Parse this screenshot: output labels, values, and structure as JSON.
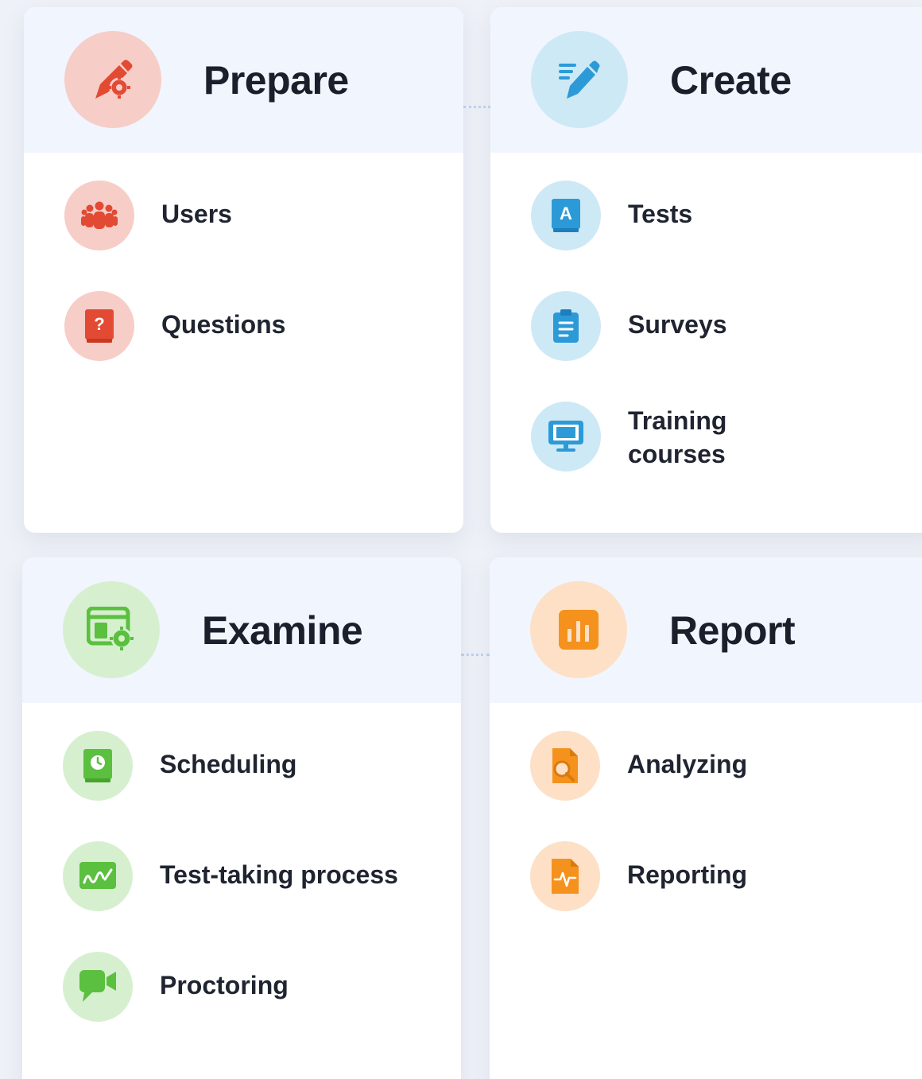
{
  "colors": {
    "prepare": {
      "bg": "#f7cdc8",
      "fg": "#e24a33"
    },
    "create": {
      "bg": "#cde9f6",
      "fg": "#2d9ad8"
    },
    "examine": {
      "bg": "#d6f0cf",
      "fg": "#5bbf3f"
    },
    "report": {
      "bg": "#fde0c6",
      "fg": "#f5921e"
    }
  },
  "cards": {
    "prepare": {
      "title": "Prepare",
      "icon": "pen-gear-icon",
      "items": [
        {
          "label": "Users",
          "icon": "users-group-icon"
        },
        {
          "label": "Questions",
          "icon": "question-book-icon"
        }
      ]
    },
    "create": {
      "title": "Create",
      "icon": "pencil-icon",
      "items": [
        {
          "label": "Tests",
          "icon": "test-book-icon"
        },
        {
          "label": "Surveys",
          "icon": "clipboard-icon"
        },
        {
          "label": "Training courses",
          "icon": "monitor-icon"
        }
      ]
    },
    "examine": {
      "title": "Examine",
      "icon": "browser-gear-icon",
      "items": [
        {
          "label": "Scheduling",
          "icon": "clock-book-icon"
        },
        {
          "label": "Test-taking process",
          "icon": "signature-board-icon"
        },
        {
          "label": "Proctoring",
          "icon": "video-chat-icon"
        }
      ]
    },
    "report": {
      "title": "Report",
      "icon": "bar-chart-icon",
      "items": [
        {
          "label": "Analyzing",
          "icon": "document-search-icon"
        },
        {
          "label": "Reporting",
          "icon": "document-pulse-icon"
        }
      ]
    }
  }
}
